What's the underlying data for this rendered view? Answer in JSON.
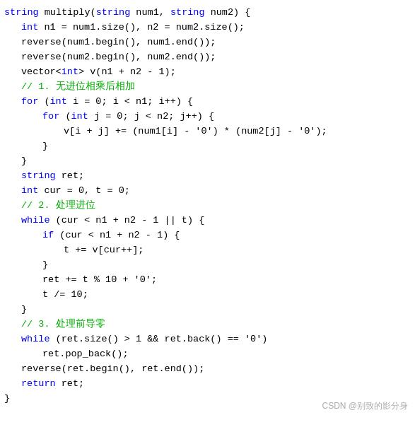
{
  "code": {
    "lines": [
      {
        "indent": 0,
        "tokens": [
          {
            "t": "kw",
            "v": "string"
          },
          {
            "t": "plain",
            "v": " multiply("
          },
          {
            "t": "kw",
            "v": "string"
          },
          {
            "t": "plain",
            "v": " num1, "
          },
          {
            "t": "kw",
            "v": "string"
          },
          {
            "t": "plain",
            "v": " num2) {"
          }
        ]
      },
      {
        "indent": 1,
        "tokens": [
          {
            "t": "kw",
            "v": "int"
          },
          {
            "t": "plain",
            "v": " n1 = num1.size(), n2 = num2.size();"
          }
        ]
      },
      {
        "indent": 1,
        "tokens": [
          {
            "t": "plain",
            "v": "reverse(num1.begin(), num1.end());"
          }
        ]
      },
      {
        "indent": 1,
        "tokens": [
          {
            "t": "plain",
            "v": "reverse(num2.begin(), num2.end());"
          }
        ]
      },
      {
        "indent": 1,
        "tokens": [
          {
            "t": "plain",
            "v": "vector<"
          },
          {
            "t": "kw",
            "v": "int"
          },
          {
            "t": "plain",
            "v": "> v(n1 + n2 - 1);"
          }
        ]
      },
      {
        "indent": 1,
        "tokens": [
          {
            "t": "cmt",
            "v": "// 1. 无进位相乘后相加"
          }
        ]
      },
      {
        "indent": 1,
        "tokens": [
          {
            "t": "kw",
            "v": "for"
          },
          {
            "t": "plain",
            "v": " ("
          },
          {
            "t": "kw",
            "v": "int"
          },
          {
            "t": "plain",
            "v": " i = 0; i < n1; i++) {"
          }
        ]
      },
      {
        "indent": 2,
        "tokens": [
          {
            "t": "kw",
            "v": "for"
          },
          {
            "t": "plain",
            "v": " ("
          },
          {
            "t": "kw",
            "v": "int"
          },
          {
            "t": "plain",
            "v": " j = 0; j < n2; j++) {"
          }
        ]
      },
      {
        "indent": 3,
        "tokens": [
          {
            "t": "plain",
            "v": "v[i + j] += (num1[i] - '0') * (num2[j] - '0');"
          }
        ]
      },
      {
        "indent": 2,
        "tokens": [
          {
            "t": "plain",
            "v": "}"
          }
        ]
      },
      {
        "indent": 1,
        "tokens": [
          {
            "t": "plain",
            "v": "}"
          }
        ]
      },
      {
        "indent": 1,
        "tokens": [
          {
            "t": "kw",
            "v": "string"
          },
          {
            "t": "plain",
            "v": " ret;"
          }
        ]
      },
      {
        "indent": 1,
        "tokens": [
          {
            "t": "kw",
            "v": "int"
          },
          {
            "t": "plain",
            "v": " cur = 0, t = 0;"
          }
        ]
      },
      {
        "indent": 1,
        "tokens": [
          {
            "t": "cmt",
            "v": "// 2. 处理进位"
          }
        ]
      },
      {
        "indent": 1,
        "tokens": [
          {
            "t": "kw",
            "v": "while"
          },
          {
            "t": "plain",
            "v": " (cur < n1 + n2 - 1 || t) {"
          }
        ]
      },
      {
        "indent": 2,
        "tokens": [
          {
            "t": "kw",
            "v": "if"
          },
          {
            "t": "plain",
            "v": " (cur < n1 + n2 - 1) {"
          }
        ]
      },
      {
        "indent": 3,
        "tokens": [
          {
            "t": "plain",
            "v": "t += v[cur++];"
          }
        ]
      },
      {
        "indent": 2,
        "tokens": [
          {
            "t": "plain",
            "v": "}"
          }
        ]
      },
      {
        "indent": 2,
        "tokens": [
          {
            "t": "plain",
            "v": "ret += t % 10 + '0';"
          }
        ]
      },
      {
        "indent": 2,
        "tokens": [
          {
            "t": "plain",
            "v": "t /= 10;"
          }
        ]
      },
      {
        "indent": 1,
        "tokens": [
          {
            "t": "plain",
            "v": "}"
          }
        ]
      },
      {
        "indent": 1,
        "tokens": [
          {
            "t": "cmt",
            "v": "// 3. 处理前导零"
          }
        ]
      },
      {
        "indent": 1,
        "tokens": [
          {
            "t": "kw",
            "v": "while"
          },
          {
            "t": "plain",
            "v": " (ret.size() > 1 && ret.back() == '0')"
          }
        ]
      },
      {
        "indent": 2,
        "tokens": [
          {
            "t": "plain",
            "v": "ret.pop_back();"
          }
        ]
      },
      {
        "indent": 1,
        "tokens": [
          {
            "t": "plain",
            "v": "reverse(ret.begin(), ret.end());"
          }
        ]
      },
      {
        "indent": 1,
        "tokens": [
          {
            "t": "kw",
            "v": "return"
          },
          {
            "t": "plain",
            "v": " ret;"
          }
        ]
      },
      {
        "indent": 0,
        "tokens": [
          {
            "t": "plain",
            "v": "}"
          }
        ]
      }
    ],
    "watermark": "CSDN @别致的影分身"
  }
}
